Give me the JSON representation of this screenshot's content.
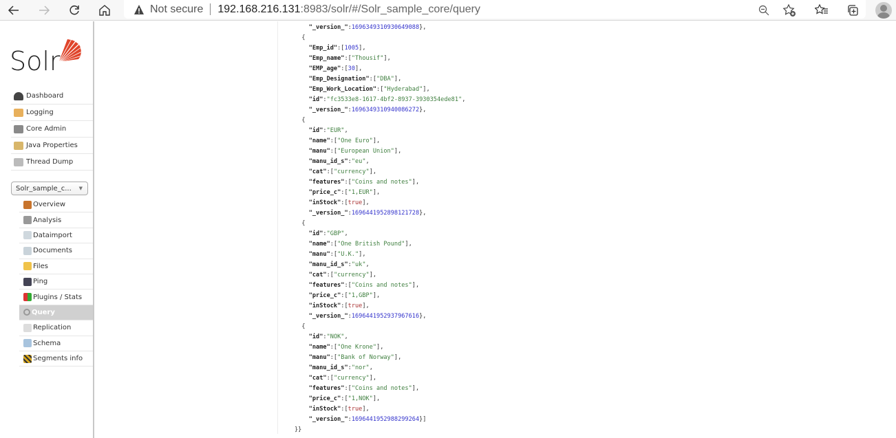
{
  "browser": {
    "security_label": "Not secure",
    "url_host": "192.168.216.131",
    "url_rest": ":8983/solr/#/Solr_sample_core/query",
    "icons": [
      "back-icon",
      "forward-icon",
      "reload-icon",
      "home-icon",
      "zoom-out-icon",
      "add-favorite-icon",
      "favorites-icon",
      "collections-icon",
      "profile-avatar"
    ]
  },
  "sidebar": {
    "logo_text": "Solr",
    "menu": [
      {
        "label": "Dashboard",
        "icon": "dashboard-icon"
      },
      {
        "label": "Logging",
        "icon": "logging-icon"
      },
      {
        "label": "Core Admin",
        "icon": "core-admin-icon"
      },
      {
        "label": "Java Properties",
        "icon": "java-properties-icon"
      },
      {
        "label": "Thread Dump",
        "icon": "thread-dump-icon"
      }
    ],
    "core_selector": "Solr_sample_c...",
    "core_menu": [
      {
        "label": "Overview",
        "icon": "overview-icon"
      },
      {
        "label": "Analysis",
        "icon": "analysis-icon"
      },
      {
        "label": "Dataimport",
        "icon": "dataimport-icon"
      },
      {
        "label": "Documents",
        "icon": "documents-icon"
      },
      {
        "label": "Files",
        "icon": "files-icon"
      },
      {
        "label": "Ping",
        "icon": "ping-icon"
      },
      {
        "label": "Plugins / Stats",
        "icon": "plugins-icon"
      },
      {
        "label": "Query",
        "icon": "query-icon",
        "active": true
      },
      {
        "label": "Replication",
        "icon": "replication-icon"
      },
      {
        "label": "Schema",
        "icon": "schema-icon"
      },
      {
        "label": "Segments info",
        "icon": "segments-icon"
      }
    ]
  },
  "results": {
    "lines": [
      {
        "indent": 2,
        "parts": [
          [
            "k",
            "\"_version_\""
          ],
          [
            "p",
            ":"
          ],
          [
            "n",
            "1696349310930649088"
          ],
          [
            "p",
            "},"
          ]
        ]
      },
      {
        "indent": 1,
        "parts": [
          [
            "p",
            "{"
          ]
        ]
      },
      {
        "indent": 2,
        "parts": [
          [
            "k",
            "\"Emp_id\""
          ],
          [
            "p",
            ":["
          ],
          [
            "n",
            "1005"
          ],
          [
            "p",
            "],"
          ]
        ]
      },
      {
        "indent": 2,
        "parts": [
          [
            "k",
            "\"Emp_name\""
          ],
          [
            "p",
            ":["
          ],
          [
            "s",
            "\"Thousif\""
          ],
          [
            "p",
            "],"
          ]
        ]
      },
      {
        "indent": 2,
        "parts": [
          [
            "k",
            "\"EMP_age\""
          ],
          [
            "p",
            ":["
          ],
          [
            "n",
            "30"
          ],
          [
            "p",
            "],"
          ]
        ]
      },
      {
        "indent": 2,
        "parts": [
          [
            "k",
            "\"Emp_Designation\""
          ],
          [
            "p",
            ":["
          ],
          [
            "s",
            "\"DBA\""
          ],
          [
            "p",
            "],"
          ]
        ]
      },
      {
        "indent": 2,
        "parts": [
          [
            "k",
            "\"Emp_Work_Location\""
          ],
          [
            "p",
            ":["
          ],
          [
            "s",
            "\"Hyderabad\""
          ],
          [
            "p",
            "],"
          ]
        ]
      },
      {
        "indent": 2,
        "parts": [
          [
            "k",
            "\"id\""
          ],
          [
            "p",
            ":"
          ],
          [
            "s",
            "\"fc3533e8-1617-4bf2-8937-3930354ede81\""
          ],
          [
            "p",
            ","
          ]
        ]
      },
      {
        "indent": 2,
        "parts": [
          [
            "k",
            "\"_version_\""
          ],
          [
            "p",
            ":"
          ],
          [
            "n",
            "1696349310940086272"
          ],
          [
            "p",
            "},"
          ]
        ]
      },
      {
        "indent": 1,
        "parts": [
          [
            "p",
            "{"
          ]
        ]
      },
      {
        "indent": 2,
        "parts": [
          [
            "k",
            "\"id\""
          ],
          [
            "p",
            ":"
          ],
          [
            "s",
            "\"EUR\""
          ],
          [
            "p",
            ","
          ]
        ]
      },
      {
        "indent": 2,
        "parts": [
          [
            "k",
            "\"name\""
          ],
          [
            "p",
            ":["
          ],
          [
            "s",
            "\"One Euro\""
          ],
          [
            "p",
            "],"
          ]
        ]
      },
      {
        "indent": 2,
        "parts": [
          [
            "k",
            "\"manu\""
          ],
          [
            "p",
            ":["
          ],
          [
            "s",
            "\"European Union\""
          ],
          [
            "p",
            "],"
          ]
        ]
      },
      {
        "indent": 2,
        "parts": [
          [
            "k",
            "\"manu_id_s\""
          ],
          [
            "p",
            ":"
          ],
          [
            "s",
            "\"eu\""
          ],
          [
            "p",
            ","
          ]
        ]
      },
      {
        "indent": 2,
        "parts": [
          [
            "k",
            "\"cat\""
          ],
          [
            "p",
            ":["
          ],
          [
            "s",
            "\"currency\""
          ],
          [
            "p",
            "],"
          ]
        ]
      },
      {
        "indent": 2,
        "parts": [
          [
            "k",
            "\"features\""
          ],
          [
            "p",
            ":["
          ],
          [
            "s",
            "\"Coins and notes\""
          ],
          [
            "p",
            "],"
          ]
        ]
      },
      {
        "indent": 2,
        "parts": [
          [
            "k",
            "\"price_c\""
          ],
          [
            "p",
            ":["
          ],
          [
            "s",
            "\"1,EUR\""
          ],
          [
            "p",
            "],"
          ]
        ]
      },
      {
        "indent": 2,
        "parts": [
          [
            "k",
            "\"inStock\""
          ],
          [
            "p",
            ":["
          ],
          [
            "b",
            "true"
          ],
          [
            "p",
            "],"
          ]
        ]
      },
      {
        "indent": 2,
        "parts": [
          [
            "k",
            "\"_version_\""
          ],
          [
            "p",
            ":"
          ],
          [
            "n",
            "1696441952898121728"
          ],
          [
            "p",
            "},"
          ]
        ]
      },
      {
        "indent": 1,
        "parts": [
          [
            "p",
            "{"
          ]
        ]
      },
      {
        "indent": 2,
        "parts": [
          [
            "k",
            "\"id\""
          ],
          [
            "p",
            ":"
          ],
          [
            "s",
            "\"GBP\""
          ],
          [
            "p",
            ","
          ]
        ]
      },
      {
        "indent": 2,
        "parts": [
          [
            "k",
            "\"name\""
          ],
          [
            "p",
            ":["
          ],
          [
            "s",
            "\"One British Pound\""
          ],
          [
            "p",
            "],"
          ]
        ]
      },
      {
        "indent": 2,
        "parts": [
          [
            "k",
            "\"manu\""
          ],
          [
            "p",
            ":["
          ],
          [
            "s",
            "\"U.K.\""
          ],
          [
            "p",
            "],"
          ]
        ]
      },
      {
        "indent": 2,
        "parts": [
          [
            "k",
            "\"manu_id_s\""
          ],
          [
            "p",
            ":"
          ],
          [
            "s",
            "\"uk\""
          ],
          [
            "p",
            ","
          ]
        ]
      },
      {
        "indent": 2,
        "parts": [
          [
            "k",
            "\"cat\""
          ],
          [
            "p",
            ":["
          ],
          [
            "s",
            "\"currency\""
          ],
          [
            "p",
            "],"
          ]
        ]
      },
      {
        "indent": 2,
        "parts": [
          [
            "k",
            "\"features\""
          ],
          [
            "p",
            ":["
          ],
          [
            "s",
            "\"Coins and notes\""
          ],
          [
            "p",
            "],"
          ]
        ]
      },
      {
        "indent": 2,
        "parts": [
          [
            "k",
            "\"price_c\""
          ],
          [
            "p",
            ":["
          ],
          [
            "s",
            "\"1,GBP\""
          ],
          [
            "p",
            "],"
          ]
        ]
      },
      {
        "indent": 2,
        "parts": [
          [
            "k",
            "\"inStock\""
          ],
          [
            "p",
            ":["
          ],
          [
            "b",
            "true"
          ],
          [
            "p",
            "],"
          ]
        ]
      },
      {
        "indent": 2,
        "parts": [
          [
            "k",
            "\"_version_\""
          ],
          [
            "p",
            ":"
          ],
          [
            "n",
            "1696441952937967616"
          ],
          [
            "p",
            "},"
          ]
        ]
      },
      {
        "indent": 1,
        "parts": [
          [
            "p",
            "{"
          ]
        ]
      },
      {
        "indent": 2,
        "parts": [
          [
            "k",
            "\"id\""
          ],
          [
            "p",
            ":"
          ],
          [
            "s",
            "\"NOK\""
          ],
          [
            "p",
            ","
          ]
        ]
      },
      {
        "indent": 2,
        "parts": [
          [
            "k",
            "\"name\""
          ],
          [
            "p",
            ":["
          ],
          [
            "s",
            "\"One Krone\""
          ],
          [
            "p",
            "],"
          ]
        ]
      },
      {
        "indent": 2,
        "parts": [
          [
            "k",
            "\"manu\""
          ],
          [
            "p",
            ":["
          ],
          [
            "s",
            "\"Bank of Norway\""
          ],
          [
            "p",
            "],"
          ]
        ]
      },
      {
        "indent": 2,
        "parts": [
          [
            "k",
            "\"manu_id_s\""
          ],
          [
            "p",
            ":"
          ],
          [
            "s",
            "\"nor\""
          ],
          [
            "p",
            ","
          ]
        ]
      },
      {
        "indent": 2,
        "parts": [
          [
            "k",
            "\"cat\""
          ],
          [
            "p",
            ":["
          ],
          [
            "s",
            "\"currency\""
          ],
          [
            "p",
            "],"
          ]
        ]
      },
      {
        "indent": 2,
        "parts": [
          [
            "k",
            "\"features\""
          ],
          [
            "p",
            ":["
          ],
          [
            "s",
            "\"Coins and notes\""
          ],
          [
            "p",
            "],"
          ]
        ]
      },
      {
        "indent": 2,
        "parts": [
          [
            "k",
            "\"price_c\""
          ],
          [
            "p",
            ":["
          ],
          [
            "s",
            "\"1,NOK\""
          ],
          [
            "p",
            "],"
          ]
        ]
      },
      {
        "indent": 2,
        "parts": [
          [
            "k",
            "\"inStock\""
          ],
          [
            "p",
            ":["
          ],
          [
            "b",
            "true"
          ],
          [
            "p",
            "],"
          ]
        ]
      },
      {
        "indent": 2,
        "parts": [
          [
            "k",
            "\"_version_\""
          ],
          [
            "p",
            ":"
          ],
          [
            "n",
            "1696441952988299264"
          ],
          [
            "p",
            "}]"
          ]
        ]
      },
      {
        "indent": 0,
        "parts": [
          [
            "p",
            "}}"
          ]
        ]
      }
    ]
  },
  "colors": {
    "key": "#222222",
    "string": "#3f7f3f",
    "number": "#3333cc",
    "boolean": "#aa3333",
    "logo_flame": "#e0452b"
  }
}
